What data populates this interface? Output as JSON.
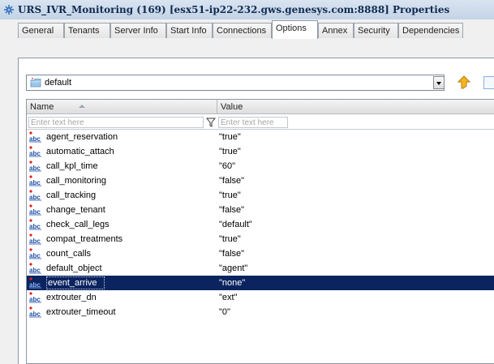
{
  "window": {
    "title": "URS_IVR_Monitoring (169) [esx51-ip22-232.gws.genesys.com:8888] Properties"
  },
  "tabs": [
    {
      "label": "General"
    },
    {
      "label": "Tenants"
    },
    {
      "label": "Server Info"
    },
    {
      "label": "Start Info"
    },
    {
      "label": "Connections"
    },
    {
      "label": "Options",
      "active": true
    },
    {
      "label": "Annex"
    },
    {
      "label": "Security"
    },
    {
      "label": "Dependencies"
    }
  ],
  "section_select": {
    "value": "default",
    "icon": "folder-icon"
  },
  "grid": {
    "columns": [
      {
        "label": "Name",
        "sort": "ascending"
      },
      {
        "label": "Value"
      }
    ],
    "filters": {
      "name_placeholder": "Enter text here",
      "value_placeholder": "Enter text here"
    },
    "row_icon": "string-option-icon",
    "rows": [
      {
        "name": "agent_reservation",
        "value": "\"true\""
      },
      {
        "name": "automatic_attach",
        "value": "\"true\""
      },
      {
        "name": "call_kpl_time",
        "value": "\"60\""
      },
      {
        "name": "call_monitoring",
        "value": "\"false\""
      },
      {
        "name": "call_tracking",
        "value": "\"true\""
      },
      {
        "name": "change_tenant",
        "value": "\"false\""
      },
      {
        "name": "check_call_legs",
        "value": "\"default\""
      },
      {
        "name": "compat_treatments",
        "value": "\"true\""
      },
      {
        "name": "count_calls",
        "value": "\"false\""
      },
      {
        "name": "default_object",
        "value": "\"agent\""
      },
      {
        "name": "event_arrive",
        "value": "\"none\"",
        "selected": true
      },
      {
        "name": "extrouter_dn",
        "value": "\"ext\""
      },
      {
        "name": "extrouter_timeout",
        "value": "\"0\""
      }
    ]
  },
  "colors": {
    "selection": "#0b2460",
    "title_text": "#102b50",
    "border": "#8d99a5"
  }
}
